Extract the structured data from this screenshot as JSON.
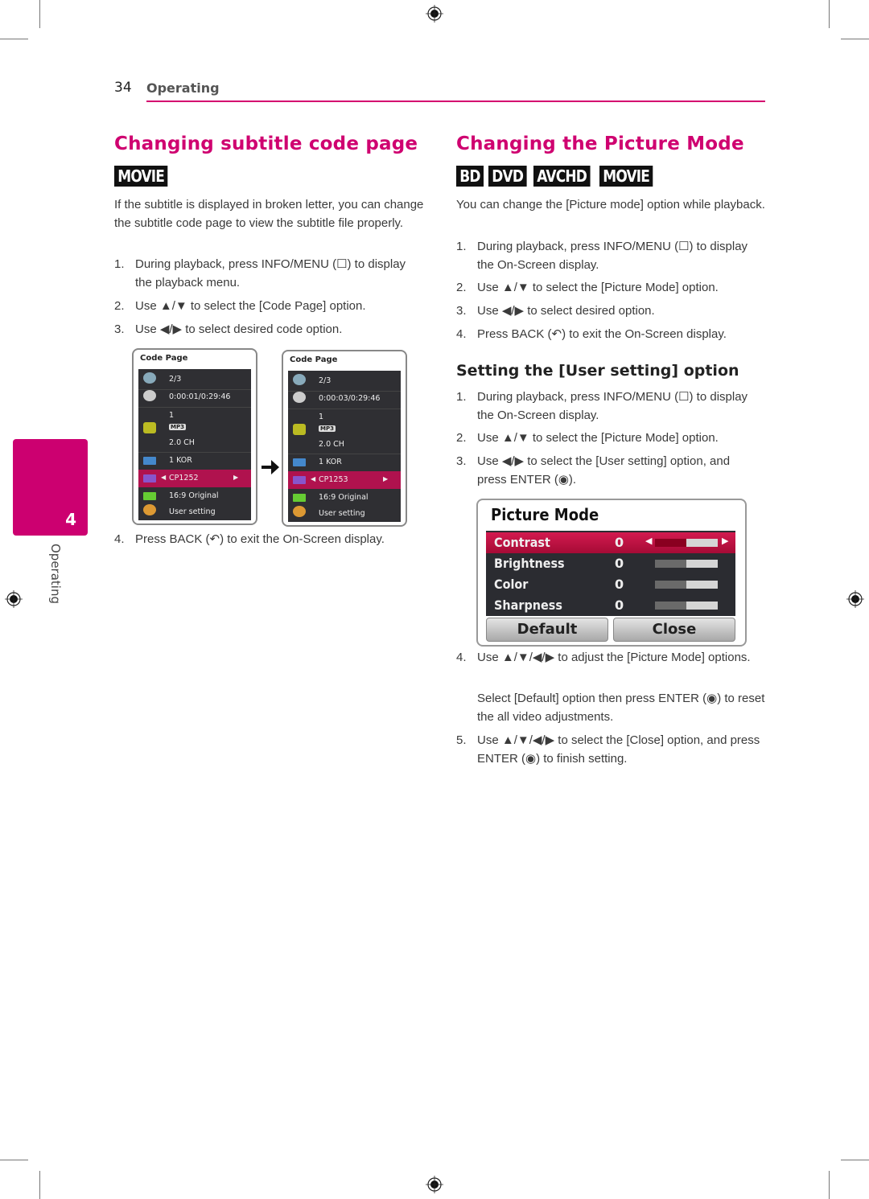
{
  "header": {
    "page_number": "34",
    "section": "Operating"
  },
  "side_tab": {
    "chapter_number": "4",
    "label": "Operating"
  },
  "left": {
    "title": "Changing subtitle code page",
    "badges": [
      "MOVIE"
    ],
    "intro": "If the subtitle is displayed in broken letter, you can change the subtitle code page to view the subtitle file properly.",
    "steps": [
      {
        "n": "1.",
        "text": "During playback, press INFO/MENU (☐) to display the playback menu."
      },
      {
        "n": "2.",
        "text": "Use ▲/▼ to select the [Code Page] option."
      },
      {
        "n": "3.",
        "text": "Use ◀/▶ to select desired code option."
      },
      {
        "n": "4.",
        "text": "Press BACK (↶) to exit the On-Screen display."
      }
    ],
    "osd_before": {
      "title": "Code Page",
      "rows": [
        "2/3",
        "0:00:01/0:29:46",
        "1",
        "MP3",
        "2.0 CH",
        "1 KOR",
        "CP1252",
        "16:9 Original",
        "User setting"
      ]
    },
    "osd_after": {
      "title": "Code Page",
      "rows": [
        "2/3",
        "0:00:03/0:29:46",
        "1",
        "MP3",
        "2.0 CH",
        "1 KOR",
        "CP1253",
        "16:9 Original",
        "User setting"
      ]
    }
  },
  "right": {
    "title": "Changing the Picture Mode",
    "badges": [
      "BD",
      "DVD",
      "AVCHD",
      "MOVIE"
    ],
    "intro": "You can change the [Picture mode] option while playback.",
    "steps": [
      {
        "n": "1.",
        "text": "During playback, press INFO/MENU (☐) to display the On-Screen display."
      },
      {
        "n": "2.",
        "text": "Use ▲/▼ to select the [Picture Mode] option."
      },
      {
        "n": "3.",
        "text": "Use ◀/▶ to select desired option."
      },
      {
        "n": "4.",
        "text": "Press BACK (↶) to exit the On-Screen display."
      }
    ],
    "subsection": {
      "title": "Setting the [User setting] option",
      "steps": [
        {
          "n": "1.",
          "text": "During playback, press INFO/MENU (☐) to display the On-Screen display."
        },
        {
          "n": "2.",
          "text": "Use ▲/▼ to select the [Picture Mode] option."
        },
        {
          "n": "3.",
          "text": "Use ◀/▶ to select the [User setting] option, and press ENTER (◉)."
        },
        {
          "n": "4.",
          "text": "Use ▲/▼/◀/▶ to adjust the [Picture Mode] options."
        },
        {
          "n": "",
          "text": "Select [Default] option then press ENTER (◉) to reset the all video adjustments."
        },
        {
          "n": "5.",
          "text": "Use ▲/▼/◀/▶ to select the [Close] option, and press ENTER (◉) to finish setting."
        }
      ]
    },
    "picture_mode_osd": {
      "title": "Picture Mode",
      "rows": [
        {
          "name": "Contrast",
          "value": "0",
          "level": 0.5
        },
        {
          "name": "Brightness",
          "value": "0",
          "level": 0.5
        },
        {
          "name": "Color",
          "value": "0",
          "level": 0.5
        },
        {
          "name": "Sharpness",
          "value": "0",
          "level": 0.5
        }
      ],
      "buttons": {
        "default": "Default",
        "close": "Close"
      }
    }
  },
  "colors": {
    "accent": "#cf0070"
  }
}
